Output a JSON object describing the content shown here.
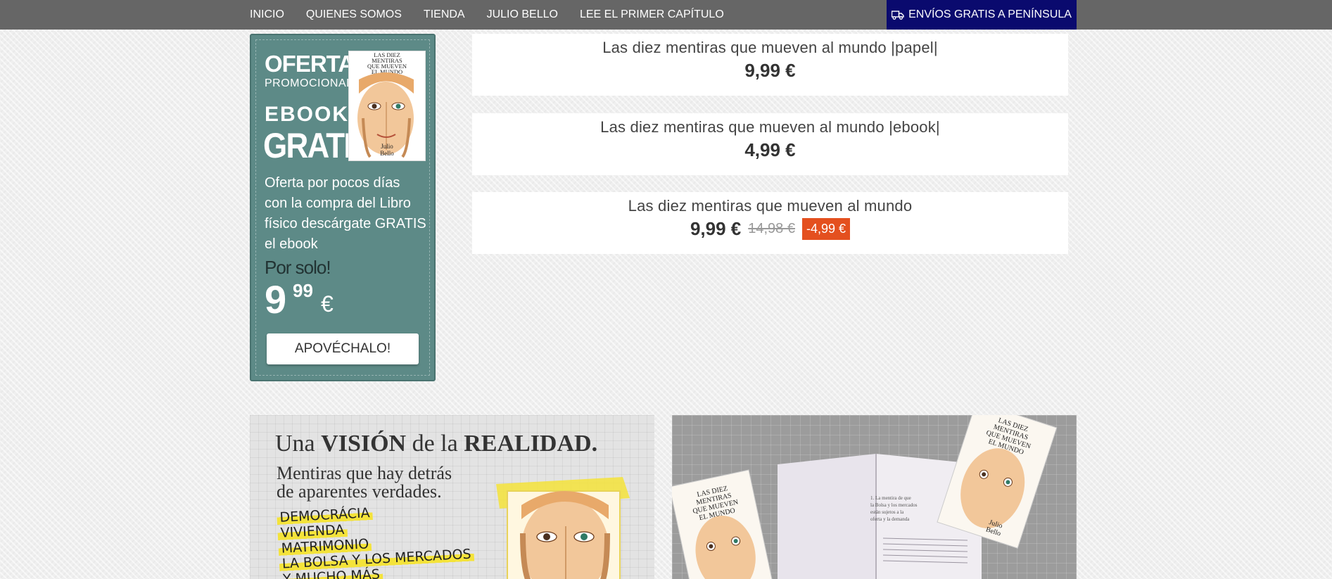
{
  "nav": {
    "items": [
      "INICIO",
      "QUIENES SOMOS",
      "TIENDA",
      "JULIO BELLO",
      "LEE EL PRIMER CAPÍTULO"
    ],
    "shipping_label": "ENVÍOS GRATIS A PENÍNSULA"
  },
  "promo": {
    "oferta": "OFERTA",
    "promocional": "PROMOCIONAL",
    "ebook": "EBOOK",
    "gratis": "GRATIS!",
    "cover_title": "LAS DIEZ MENTIRAS QUE MUEVEN EL MUNDO",
    "cover_author": "Julio Bello",
    "description": "Oferta por pocos días con la compra del Libro físico descárgate GRATIS el ebook",
    "por_solo": "Por solo!",
    "price_int": "9",
    "price_dec": "99",
    "currency": "€",
    "button": "APOVÉCHALO!"
  },
  "products": [
    {
      "name": "Las diez mentiras que mueven al mundo |papel|",
      "price": "9,99 €"
    },
    {
      "name": "Las diez mentiras que mueven al mundo |ebook|",
      "price": "4,99 €"
    },
    {
      "name": "Las diez mentiras que mueven al mundo",
      "price": "9,99 €",
      "old_price": "14,98 €",
      "discount": "-4,99 €"
    }
  ],
  "banner_left": {
    "title_1": "Una",
    "title_2": "VISIÓN",
    "title_3": "de la",
    "title_4": "REALIDAD.",
    "subtitle_1": "Mentiras que hay detrás",
    "subtitle_2": "de aparentes verdades.",
    "list": [
      "DEMOCRÁCIA",
      "VIVIENDA",
      "MATRIMONIO",
      "LA BOLSA Y LOS MERCADOS",
      "Y MUCHO MÁS"
    ]
  },
  "banner_right": {
    "cover_title": "LAS DIEZ MENTIRAS QUE MUEVEN EL MUNDO",
    "cover_author": "Julio Bello",
    "page_text": "1. La mentira de que la Bolsa y los mercados están sujetos a la oferta y la demanda"
  },
  "colors": {
    "nav_bg": "#666666",
    "ship_bg": "#0a0a6e",
    "promo_bg": "#5d8a87",
    "discount": "#e4501f"
  }
}
